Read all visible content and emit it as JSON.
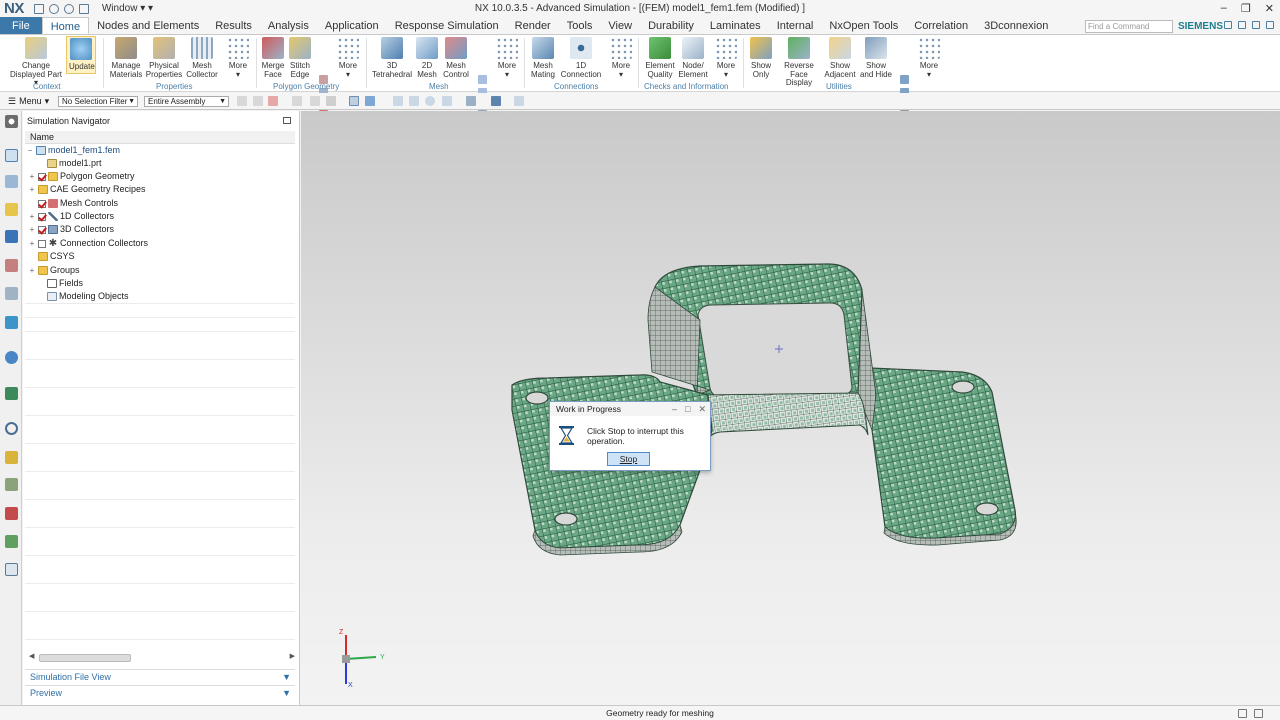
{
  "app": {
    "logo": "NX",
    "title": "NX 10.0.3.5 - Advanced Simulation - [(FEM) model1_fem1.fem (Modified) ]",
    "window_menu": "Window",
    "brand": "SIEMENS",
    "find_placeholder": "Find a Command"
  },
  "tabs": [
    "File",
    "Home",
    "Nodes and Elements",
    "Results",
    "Analysis",
    "Application",
    "Response Simulation",
    "Render",
    "Tools",
    "View",
    "Durability",
    "Laminates",
    "Internal",
    "NxOpen Tools",
    "Correlation",
    "3Dconnexion"
  ],
  "ribbon": {
    "buttons": [
      {
        "l1": "Change",
        "l2": "Displayed Part ▾"
      },
      {
        "l1": "Update",
        "l2": ""
      },
      {
        "l1": "Manage",
        "l2": "Materials"
      },
      {
        "l1": "Physical",
        "l2": "Properties"
      },
      {
        "l1": "Mesh",
        "l2": "Collector"
      },
      {
        "l1": "More",
        "l2": "▾"
      },
      {
        "l1": "Merge",
        "l2": "Face"
      },
      {
        "l1": "Stitch",
        "l2": "Edge"
      },
      {
        "l1": "More",
        "l2": "▾"
      },
      {
        "l1": "3D",
        "l2": "Tetrahedral"
      },
      {
        "l1": "2D",
        "l2": "Mesh"
      },
      {
        "l1": "Mesh",
        "l2": "Control"
      },
      {
        "l1": "More",
        "l2": "▾"
      },
      {
        "l1": "Mesh",
        "l2": "Mating"
      },
      {
        "l1": "1D",
        "l2": "Connection"
      },
      {
        "l1": "More",
        "l2": "▾"
      },
      {
        "l1": "Element",
        "l2": "Quality"
      },
      {
        "l1": "Node/",
        "l2": "Element"
      },
      {
        "l1": "More",
        "l2": "▾"
      },
      {
        "l1": "Show",
        "l2": "Only"
      },
      {
        "l1": "Reverse",
        "l2": "Face Display"
      },
      {
        "l1": "Show",
        "l2": "Adjacent"
      },
      {
        "l1": "Show",
        "l2": "and Hide"
      },
      {
        "l1": "More",
        "l2": "▾"
      }
    ],
    "groups": [
      "Context",
      "Properties",
      "Polygon Geometry",
      "Mesh",
      "Connections",
      "Checks and Information",
      "Utilities"
    ]
  },
  "selection_bar": {
    "menu": "Menu",
    "filter": "No Selection Filter",
    "scope": "Entire Assembly"
  },
  "navigator": {
    "title": "Simulation Navigator",
    "column": "Name",
    "items": [
      {
        "label": "model1_fem1.fem"
      },
      {
        "label": "model1.prt"
      },
      {
        "label": "Polygon Geometry"
      },
      {
        "label": "CAE Geometry Recipes"
      },
      {
        "label": "Mesh Controls"
      },
      {
        "label": "1D Collectors"
      },
      {
        "label": "3D Collectors"
      },
      {
        "label": "Connection Collectors"
      },
      {
        "label": "CSYS"
      },
      {
        "label": "Groups"
      },
      {
        "label": "Fields"
      },
      {
        "label": "Modeling Objects"
      }
    ],
    "panels": [
      "Simulation File View",
      "Preview"
    ]
  },
  "dialog": {
    "title": "Work in Progress",
    "message": "Click Stop to interrupt this operation.",
    "button": "Stop"
  },
  "status": {
    "text": "Geometry ready for meshing"
  },
  "colors": {
    "accent": "#3c78a8",
    "mesh": "#5d9f7d",
    "brand": "#1d7f8c"
  },
  "triad": {
    "x": "X",
    "y": "Y",
    "z": "Z"
  }
}
